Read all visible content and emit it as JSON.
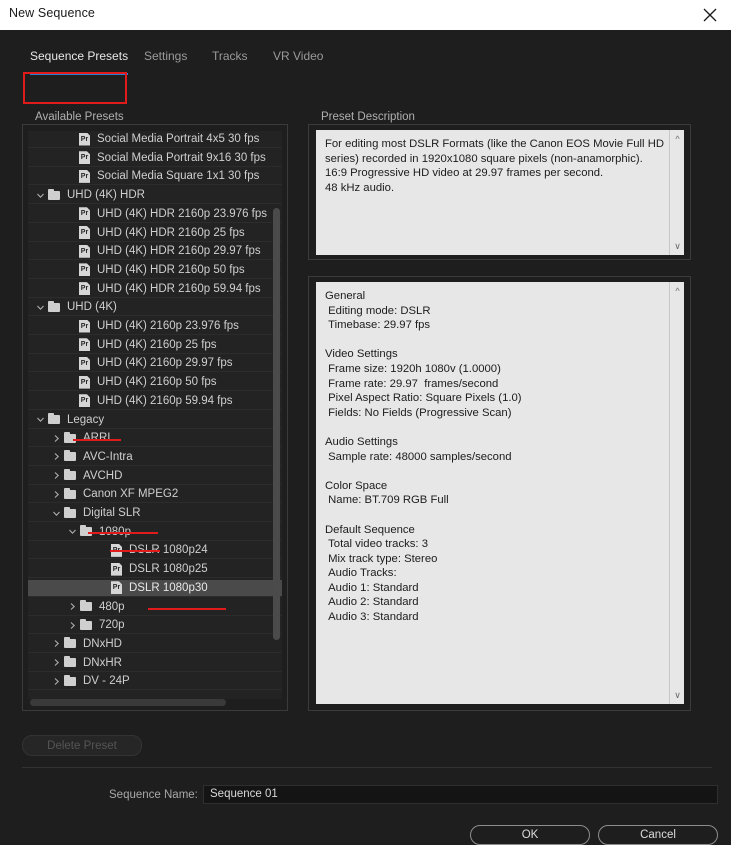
{
  "window": {
    "title": "New Sequence",
    "close_icon": "close-icon"
  },
  "tabs": [
    {
      "label": "Sequence Presets",
      "active": true
    },
    {
      "label": "Settings",
      "active": false
    },
    {
      "label": "Tracks",
      "active": false
    },
    {
      "label": "VR Video",
      "active": false
    }
  ],
  "groups": {
    "available_presets": "Available Presets",
    "preset_description": "Preset Description"
  },
  "tree": {
    "rows": [
      {
        "label": "Social Media Portrait 4x5 30 fps",
        "icon": "pr-preset-icon",
        "indent": 3,
        "twisty": "",
        "selected": false
      },
      {
        "label": "Social Media Portrait 9x16 30 fps",
        "icon": "pr-preset-icon",
        "indent": 3,
        "twisty": "",
        "selected": false
      },
      {
        "label": "Social Media Square 1x1 30 fps",
        "icon": "pr-preset-icon",
        "indent": 3,
        "twisty": "",
        "selected": false
      },
      {
        "label": "UHD (4K) HDR",
        "icon": "folder-icon",
        "indent": 1,
        "twisty": "v",
        "selected": false
      },
      {
        "label": "UHD (4K) HDR 2160p 23.976 fps",
        "icon": "pr-preset-icon",
        "indent": 3,
        "twisty": "",
        "selected": false
      },
      {
        "label": "UHD (4K) HDR 2160p 25 fps",
        "icon": "pr-preset-icon",
        "indent": 3,
        "twisty": "",
        "selected": false
      },
      {
        "label": "UHD (4K) HDR 2160p 29.97 fps",
        "icon": "pr-preset-icon",
        "indent": 3,
        "twisty": "",
        "selected": false
      },
      {
        "label": "UHD (4K) HDR 2160p 50 fps",
        "icon": "pr-preset-icon",
        "indent": 3,
        "twisty": "",
        "selected": false
      },
      {
        "label": "UHD (4K) HDR 2160p 59.94 fps",
        "icon": "pr-preset-icon",
        "indent": 3,
        "twisty": "",
        "selected": false
      },
      {
        "label": "UHD (4K)",
        "icon": "folder-icon",
        "indent": 1,
        "twisty": "v",
        "selected": false
      },
      {
        "label": "UHD (4K) 2160p 23.976 fps",
        "icon": "pr-preset-icon",
        "indent": 3,
        "twisty": "",
        "selected": false
      },
      {
        "label": "UHD (4K) 2160p 25 fps",
        "icon": "pr-preset-icon",
        "indent": 3,
        "twisty": "",
        "selected": false
      },
      {
        "label": "UHD (4K) 2160p 29.97 fps",
        "icon": "pr-preset-icon",
        "indent": 3,
        "twisty": "",
        "selected": false
      },
      {
        "label": "UHD (4K) 2160p 50 fps",
        "icon": "pr-preset-icon",
        "indent": 3,
        "twisty": "",
        "selected": false
      },
      {
        "label": "UHD (4K) 2160p 59.94 fps",
        "icon": "pr-preset-icon",
        "indent": 3,
        "twisty": "",
        "selected": false
      },
      {
        "label": "Legacy",
        "icon": "folder-icon",
        "indent": 1,
        "twisty": "v",
        "selected": false
      },
      {
        "label": "ARRI",
        "icon": "folder-icon",
        "indent": 2,
        "twisty": ">",
        "selected": false
      },
      {
        "label": "AVC-Intra",
        "icon": "folder-icon",
        "indent": 2,
        "twisty": ">",
        "selected": false
      },
      {
        "label": "AVCHD",
        "icon": "folder-icon",
        "indent": 2,
        "twisty": ">",
        "selected": false
      },
      {
        "label": "Canon XF MPEG2",
        "icon": "folder-icon",
        "indent": 2,
        "twisty": ">",
        "selected": false
      },
      {
        "label": "Digital SLR",
        "icon": "folder-icon",
        "indent": 2,
        "twisty": "v",
        "selected": false
      },
      {
        "label": "1080p",
        "icon": "folder-icon",
        "indent": 3,
        "twisty": "v",
        "selected": false
      },
      {
        "label": "DSLR 1080p24",
        "icon": "pr-preset-icon",
        "indent": 5,
        "twisty": "",
        "selected": false
      },
      {
        "label": "DSLR 1080p25",
        "icon": "pr-preset-icon",
        "indent": 5,
        "twisty": "",
        "selected": false
      },
      {
        "label": "DSLR 1080p30",
        "icon": "pr-preset-icon",
        "indent": 5,
        "twisty": "",
        "selected": true
      },
      {
        "label": "480p",
        "icon": "folder-icon",
        "indent": 3,
        "twisty": ">",
        "selected": false
      },
      {
        "label": "720p",
        "icon": "folder-icon",
        "indent": 3,
        "twisty": ">",
        "selected": false
      },
      {
        "label": "DNxHD",
        "icon": "folder-icon",
        "indent": 2,
        "twisty": ">",
        "selected": false
      },
      {
        "label": "DNxHR",
        "icon": "folder-icon",
        "indent": 2,
        "twisty": ">",
        "selected": false
      },
      {
        "label": "DV - 24P",
        "icon": "folder-icon",
        "indent": 2,
        "twisty": ">",
        "selected": false
      }
    ]
  },
  "description": {
    "text": "For editing most DSLR Formats (like the Canon EOS Movie Full HD\nseries) recorded in 1920x1080 square pixels (non-anamorphic).\n16:9 Progressive HD video at 29.97 frames per second.\n48 kHz audio."
  },
  "settings": {
    "text": "General\n Editing mode: DSLR\n Timebase: 29.97 fps\n\nVideo Settings\n Frame size: 1920h 1080v (1.0000)\n Frame rate: 29.97  frames/second\n Pixel Aspect Ratio: Square Pixels (1.0)\n Fields: No Fields (Progressive Scan)\n\nAudio Settings\n Sample rate: 48000 samples/second\n\nColor Space\n Name: BT.709 RGB Full\n\nDefault Sequence\n Total video tracks: 3\n Mix track type: Stereo\n Audio Tracks:\n Audio 1: Standard\n Audio 2: Standard\n Audio 3: Standard"
  },
  "footer": {
    "delete_preset_label": "Delete Preset",
    "sequence_name_label": "Sequence Name:",
    "sequence_name_value": "Sequence 01",
    "ok_label": "OK",
    "cancel_label": "Cancel"
  },
  "colors": {
    "accent_blue": "#2b7fd4",
    "annotation_red": "#e01b1b",
    "dialog_bg": "#1e1e1e",
    "pane_bg": "#e7e7e7",
    "selection": "#4a4a4a"
  }
}
